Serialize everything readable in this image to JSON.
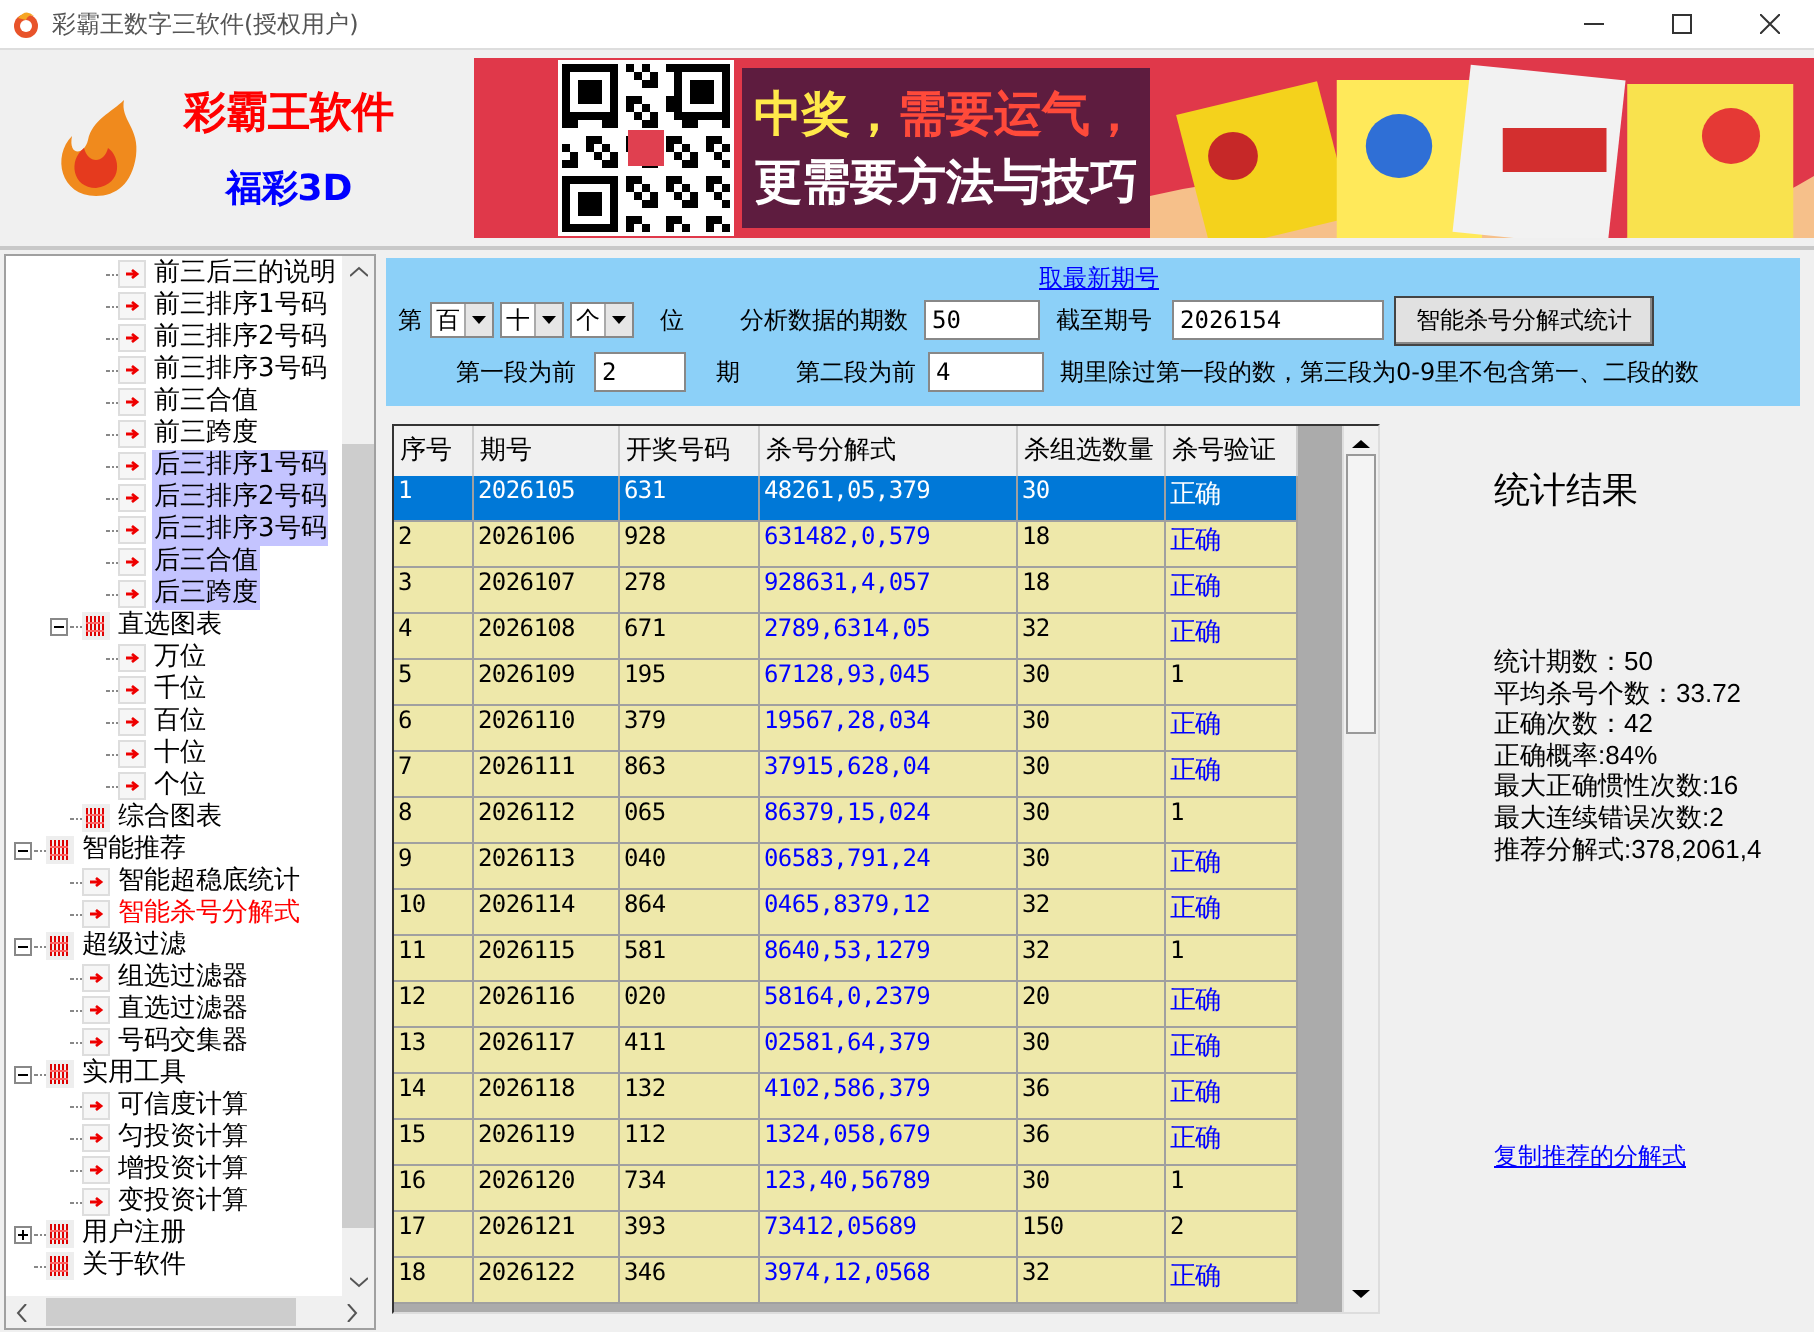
{
  "window": {
    "title": "彩霸王数字三软件(授权用户)"
  },
  "header": {
    "brand": "彩霸王软件",
    "product": "福彩3D",
    "slogan": [
      [
        "中奖，",
        "需要运气，"
      ],
      [
        "更需要方法与技巧"
      ]
    ]
  },
  "tree": {
    "items": [
      {
        "children": [
          {
            "children": [
              {
                "label": "前三后三的说明",
                "kind": "page",
                "selected": false,
                "active": false
              },
              {
                "label": "前三排序1号码",
                "kind": "page",
                "selected": false,
                "active": false
              },
              {
                "label": "前三排序2号码",
                "kind": "page",
                "selected": false,
                "active": false
              },
              {
                "label": "前三排序3号码",
                "kind": "page",
                "selected": false,
                "active": false
              },
              {
                "label": "前三合值",
                "kind": "page",
                "selected": false,
                "active": false
              },
              {
                "label": "前三跨度",
                "kind": "page",
                "selected": false,
                "active": false
              },
              {
                "label": "后三排序1号码",
                "kind": "page",
                "selected": true,
                "active": false
              },
              {
                "label": "后三排序2号码",
                "kind": "page",
                "selected": true,
                "active": false
              },
              {
                "label": "后三排序3号码",
                "kind": "page",
                "selected": true,
                "active": false
              },
              {
                "label": "后三合值",
                "kind": "page",
                "selected": true,
                "active": false
              },
              {
                "label": "后三跨度",
                "kind": "page",
                "selected": true,
                "active": false
              }
            ]
          },
          {
            "label": "直选图表",
            "kind": "grid",
            "expanded": true,
            "selected": false,
            "active": false,
            "children": [
              {
                "label": "万位",
                "kind": "page",
                "selected": false,
                "active": false
              },
              {
                "label": "千位",
                "kind": "page",
                "selected": false,
                "active": false
              },
              {
                "label": "百位",
                "kind": "page",
                "selected": false,
                "active": false
              },
              {
                "label": "十位",
                "kind": "page",
                "selected": false,
                "active": false
              },
              {
                "label": "个位",
                "kind": "page",
                "selected": false,
                "active": false
              }
            ]
          },
          {
            "label": "综合图表",
            "kind": "grid",
            "selected": false,
            "active": false
          }
        ]
      },
      {
        "label": "智能推荐",
        "kind": "grid",
        "expanded": true,
        "selected": false,
        "active": false,
        "children": [
          {
            "label": "智能超稳底统计",
            "kind": "page",
            "selected": false,
            "active": false
          },
          {
            "label": "智能杀号分解式",
            "kind": "page",
            "selected": false,
            "active": true
          }
        ]
      },
      {
        "label": "超级过滤",
        "kind": "grid",
        "expanded": true,
        "selected": false,
        "active": false,
        "children": [
          {
            "label": "组选过滤器",
            "kind": "page",
            "selected": false,
            "active": false
          },
          {
            "label": "直选过滤器",
            "kind": "page",
            "selected": false,
            "active": false
          },
          {
            "label": "号码交集器",
            "kind": "page",
            "selected": false,
            "active": false
          }
        ]
      },
      {
        "label": "实用工具",
        "kind": "grid",
        "expanded": true,
        "selected": false,
        "active": false,
        "children": [
          {
            "label": "可信度计算",
            "kind": "page",
            "selected": false,
            "active": false
          },
          {
            "label": "匀投资计算",
            "kind": "page",
            "selected": false,
            "active": false
          },
          {
            "label": "增投资计算",
            "kind": "page",
            "selected": false,
            "active": false
          },
          {
            "label": "变投资计算",
            "kind": "page",
            "selected": false,
            "active": false
          }
        ]
      },
      {
        "label": "用户注册",
        "kind": "grid",
        "expanded": false,
        "selected": false,
        "active": false
      },
      {
        "label": "关于软件",
        "kind": "grid",
        "selected": false,
        "active": false
      }
    ]
  },
  "controls": {
    "fetch_link": "取最新期号",
    "prefix": "第",
    "positions": [
      "百",
      "十",
      "个"
    ],
    "position_suffix": "位",
    "periods_label": "分析数据的期数",
    "periods": "50",
    "until_label": "截至期号",
    "until": "2026154",
    "run_button": "智能杀号分解式统计",
    "seg1_label": "第一段为前",
    "seg1": "2",
    "seg1_suffix": "期",
    "seg2_label": "第二段为前",
    "seg2": "4",
    "note": "期里除过第一段的数，第三段为0-9里不包含第一、二段的数"
  },
  "table": {
    "columns": [
      "序号",
      "期号",
      "开奖号码",
      "杀号分解式",
      "杀组选数量",
      "杀号验证"
    ],
    "rows": [
      {
        "cells": [
          "1",
          "2026105",
          "631",
          "48261,05,379",
          "30",
          "正确"
        ],
        "correct": true,
        "selected": true
      },
      {
        "cells": [
          "2",
          "2026106",
          "928",
          "631482,0,579",
          "18",
          "正确"
        ],
        "correct": true,
        "selected": false
      },
      {
        "cells": [
          "3",
          "2026107",
          "278",
          "928631,4,057",
          "18",
          "正确"
        ],
        "correct": true,
        "selected": false
      },
      {
        "cells": [
          "4",
          "2026108",
          "671",
          "2789,6314,05",
          "32",
          "正确"
        ],
        "correct": true,
        "selected": false
      },
      {
        "cells": [
          "5",
          "2026109",
          "195",
          "67128,93,045",
          "30",
          "1"
        ],
        "correct": false,
        "selected": false
      },
      {
        "cells": [
          "6",
          "2026110",
          "379",
          "19567,28,034",
          "30",
          "正确"
        ],
        "correct": true,
        "selected": false
      },
      {
        "cells": [
          "7",
          "2026111",
          "863",
          "37915,628,04",
          "30",
          "正确"
        ],
        "correct": true,
        "selected": false
      },
      {
        "cells": [
          "8",
          "2026112",
          "065",
          "86379,15,024",
          "30",
          "1"
        ],
        "correct": false,
        "selected": false
      },
      {
        "cells": [
          "9",
          "2026113",
          "040",
          "06583,791,24",
          "30",
          "正确"
        ],
        "correct": true,
        "selected": false
      },
      {
        "cells": [
          "10",
          "2026114",
          "864",
          "0465,8379,12",
          "32",
          "正确"
        ],
        "correct": true,
        "selected": false
      },
      {
        "cells": [
          "11",
          "2026115",
          "581",
          "8640,53,1279",
          "32",
          "1"
        ],
        "correct": false,
        "selected": false
      },
      {
        "cells": [
          "12",
          "2026116",
          "020",
          "58164,0,2379",
          "20",
          "正确"
        ],
        "correct": true,
        "selected": false
      },
      {
        "cells": [
          "13",
          "2026117",
          "411",
          "02581,64,379",
          "30",
          "正确"
        ],
        "correct": true,
        "selected": false
      },
      {
        "cells": [
          "14",
          "2026118",
          "132",
          "4102,586,379",
          "36",
          "正确"
        ],
        "correct": true,
        "selected": false
      },
      {
        "cells": [
          "15",
          "2026119",
          "112",
          "1324,058,679",
          "36",
          "正确"
        ],
        "correct": true,
        "selected": false
      },
      {
        "cells": [
          "16",
          "2026120",
          "734",
          "123,40,56789",
          "30",
          "1"
        ],
        "correct": false,
        "selected": false
      },
      {
        "cells": [
          "17",
          "2026121",
          "393",
          "73412,05689",
          "150",
          "2"
        ],
        "correct": false,
        "selected": false
      },
      {
        "cells": [
          "18",
          "2026122",
          "346",
          "3974,12,0568",
          "32",
          "正确"
        ],
        "correct": true,
        "selected": false
      }
    ]
  },
  "stats": {
    "title": "统计结果",
    "lines": [
      "统计期数：50",
      "平均杀号个数：33.72",
      "正确次数：42",
      "正确概率:84%",
      "最大正确惯性次数:16",
      "最大连续错误次数:2",
      "推荐分解式:378,2061,4"
    ],
    "copy_link": "复制推荐的分解式"
  }
}
